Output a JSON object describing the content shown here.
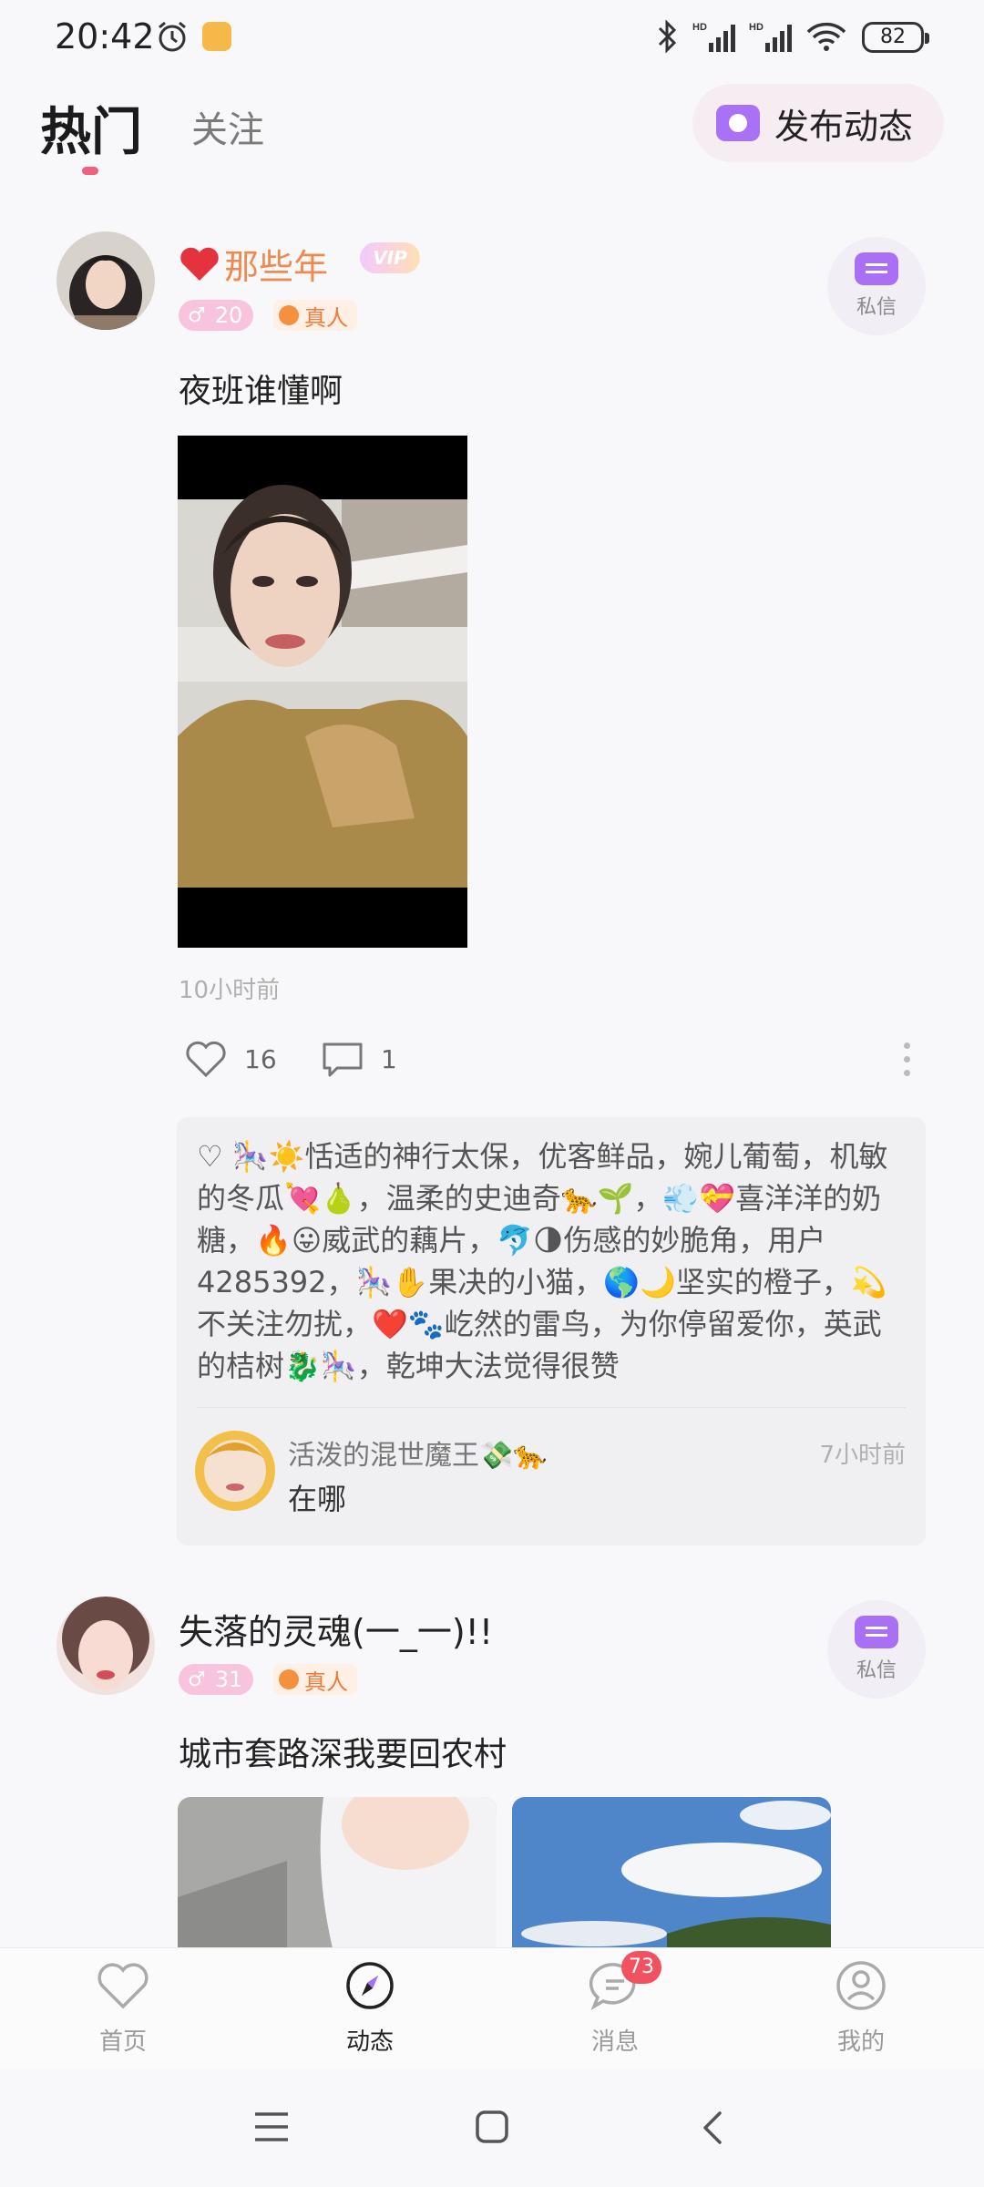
{
  "status_bar": {
    "time": "20:42",
    "battery": "82",
    "icons": [
      "alarm-icon",
      "notification-app-icon",
      "bluetooth-icon",
      "signal-hd-icon",
      "signal-hd-icon",
      "wifi-icon",
      "battery-icon"
    ]
  },
  "header": {
    "tabs": [
      {
        "label": "热门",
        "active": true
      },
      {
        "label": "关注",
        "active": false
      }
    ],
    "publish_label": "发布动态"
  },
  "posts": [
    {
      "username": "那些年",
      "name_prefix_icon": "heart-icon",
      "vip": "VIP",
      "level": "20",
      "verified": "真人",
      "dm_label": "私信",
      "text": "夜班谁懂啊",
      "time_ago": "10小时前",
      "likes": "16",
      "comments": "1",
      "likers_text": "♡ 🎠☀️恬适的神行太保，优客鲜品，婉儿葡萄，机敏的冬瓜💘🍐，温柔的史迪奇🐆🌱，💨💝喜洋洋的奶糖，🔥😛威武的藕片，🐬🌗伤感的妙脆角，用户4285392，🎠✋果决的小猫，🌎🌙坚实的橙子，💫不关注勿扰，❤️🐾屹然的雷鸟，为你停留爱你，英武的桔树🐉🎠，乾坤大法觉得很赞",
      "comment": {
        "name": "活泼的混世魔王💸🐆",
        "time": "7小时前",
        "text": "在哪"
      }
    },
    {
      "username": "失落的灵魂(一_一)!!",
      "level": "31",
      "verified": "真人",
      "dm_label": "私信",
      "text": "城市套路深我要回农村"
    }
  ],
  "bottom_nav": [
    {
      "label": "首页",
      "icon": "heart-outline-icon",
      "active": false
    },
    {
      "label": "动态",
      "icon": "compass-icon",
      "active": true
    },
    {
      "label": "消息",
      "icon": "chat-bubble-icon",
      "active": false,
      "badge": "73"
    },
    {
      "label": "我的",
      "icon": "user-circle-icon",
      "active": false
    }
  ],
  "colors": {
    "accent_purple": "#a971f5",
    "accent_pink": "#f0617e",
    "badge_red": "#f2515f",
    "verified_orange": "#ee7a3b"
  }
}
